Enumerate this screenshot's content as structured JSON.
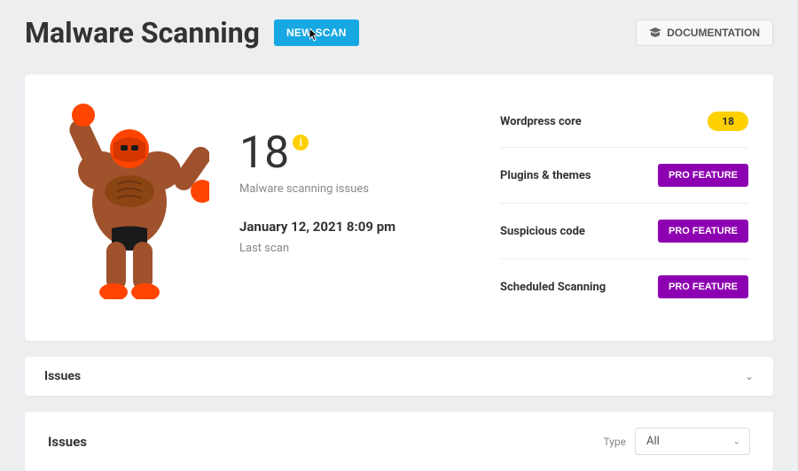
{
  "header": {
    "title": "Malware Scanning",
    "new_scan": "NEW SCAN",
    "documentation": "DOCUMENTATION"
  },
  "summary": {
    "issue_count": "18",
    "issue_label": "Malware scanning issues",
    "last_scan_date": "January 12, 2021 8:09 pm",
    "last_scan_label": "Last scan"
  },
  "rows": {
    "wordpress_core": {
      "label": "Wordpress core",
      "count": "18"
    },
    "plugins_themes": {
      "label": "Plugins & themes",
      "badge": "PRO FEATURE"
    },
    "suspicious_code": {
      "label": "Suspicious code",
      "badge": "PRO FEATURE"
    },
    "scheduled_scanning": {
      "label": "Scheduled Scanning",
      "badge": "PRO FEATURE"
    }
  },
  "accordion": {
    "title": "Issues"
  },
  "issues_panel": {
    "title": "Issues",
    "type_label": "Type",
    "type_value": "All"
  }
}
